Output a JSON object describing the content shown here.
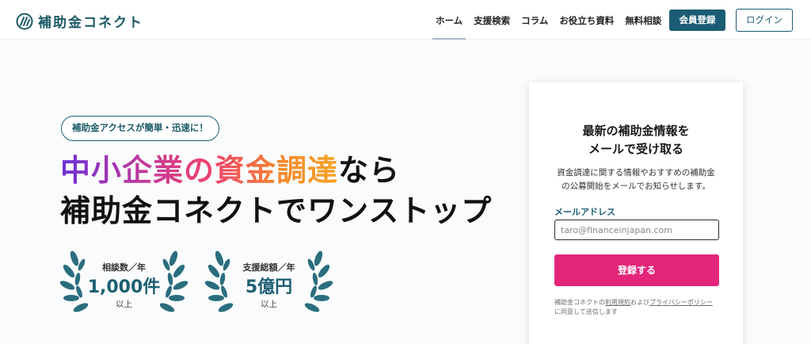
{
  "header": {
    "logo_text": "補助金コネクト",
    "nav": [
      {
        "label": "ホーム",
        "active": true
      },
      {
        "label": "支援検索",
        "active": false
      },
      {
        "label": "コラム",
        "active": false
      },
      {
        "label": "お役立ち資料",
        "active": false
      },
      {
        "label": "無料相談",
        "active": false
      }
    ],
    "register_label": "会員登録",
    "login_label": "ログイン"
  },
  "hero": {
    "badge": "補助金アクセスが簡単・迅速に！",
    "line1_gradient": "中小企業の資金調達",
    "line1_plain": "なら",
    "line2": "補助金コネクトでワンストップ",
    "awards": [
      {
        "label": "相談数／年",
        "value": "1,000件",
        "unit": "以上"
      },
      {
        "label": "支援総額／年",
        "value": "5億円",
        "unit": "以上"
      }
    ]
  },
  "form": {
    "title_line1": "最新の補助金情報を",
    "title_line2": "メールで受け取る",
    "desc_line1": "資金調達に関する情報やおすすめの補助金",
    "desc_line2": "の公募開始をメールでお知らせします。",
    "email_label": "メールアドレス",
    "email_placeholder": "taro@financeinjapan.com",
    "submit_label": "登録する",
    "consent_prefix": "補助金コネクトの",
    "consent_terms": "利用規約",
    "consent_and": "および",
    "consent_privacy": "プライバシーポリシー",
    "consent_suffix": "に同意して送信します"
  },
  "colors": {
    "brand": "#1a5c73",
    "accent": "#e3267a",
    "laurel": "#2a6e7e"
  }
}
